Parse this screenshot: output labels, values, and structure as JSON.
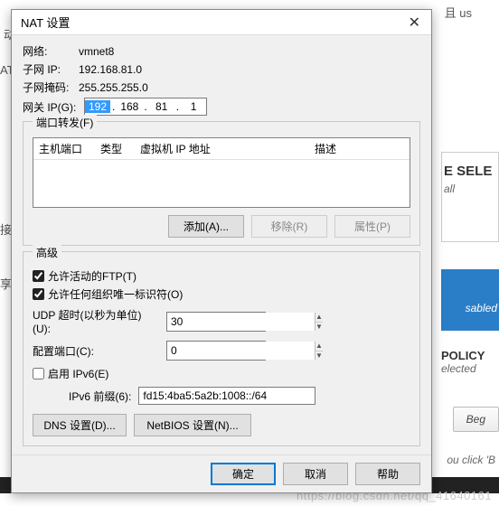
{
  "background": {
    "top_label": "且 us",
    "left1": "动挡",
    "left2": "AT",
    "left3": "接",
    "left4": "享",
    "sele_title": "E SELE",
    "sele_sub": "all",
    "blue_label": "sabled",
    "policy_title": "POLICY",
    "policy_sub": "elected",
    "begin_btn": "Beg",
    "footer_text": "ou click 'B",
    "watermark": "https://blog.csdn.net/qq_41640161"
  },
  "dialog": {
    "title": "NAT 设置",
    "network_lbl": "网络:",
    "network_val": "vmnet8",
    "subnet_ip_lbl": "子网 IP:",
    "subnet_ip_val": "192.168.81.0",
    "subnet_mask_lbl": "子网掩码:",
    "subnet_mask_val": "255.255.255.0",
    "gateway_lbl": "网关 IP(G):",
    "gateway_ip": {
      "o1": "192",
      "o2": "168",
      "o3": "81",
      "o4": "1"
    },
    "portfw_group": "端口转发(F)",
    "tbl": {
      "c1": "主机端口",
      "c2": "类型",
      "c3": "虚拟机 IP 地址",
      "c4": "描述"
    },
    "add_btn": "添加(A)...",
    "remove_btn": "移除(R)",
    "props_btn": "属性(P)",
    "adv_group": "高级",
    "allow_ftp": "允许活动的FTP(T)",
    "allow_oui": "允许任何组织唯一标识符(O)",
    "udp_timeout_lbl": "UDP 超时(以秒为单位)(U):",
    "udp_timeout_val": "30",
    "cfg_port_lbl": "配置端口(C):",
    "cfg_port_val": "0",
    "enable_ipv6": "启用 IPv6(E)",
    "ipv6_prefix_lbl": "IPv6 前缀(6):",
    "ipv6_prefix_val": "fd15:4ba5:5a2b:1008::/64",
    "dns_btn": "DNS 设置(D)...",
    "netbios_btn": "NetBIOS 设置(N)...",
    "ok": "确定",
    "cancel": "取消",
    "help": "帮助"
  }
}
